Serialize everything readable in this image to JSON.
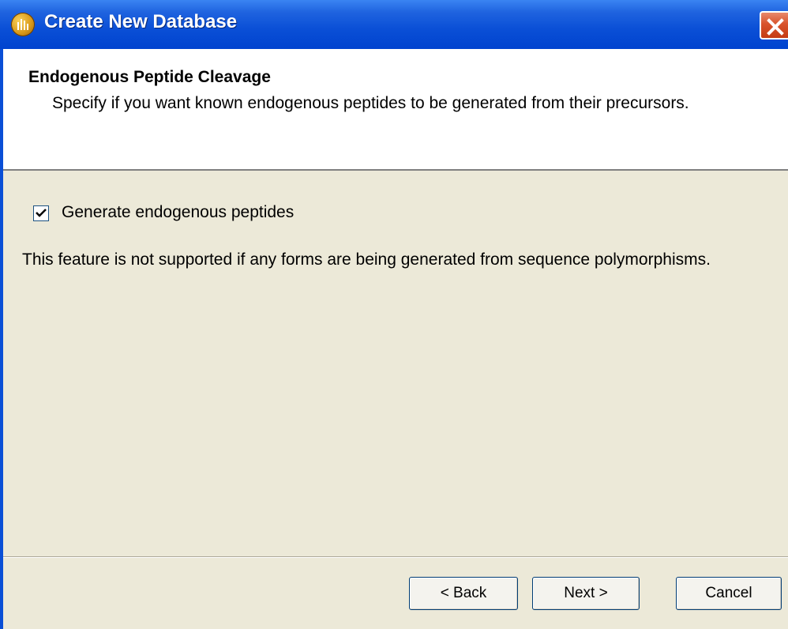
{
  "window": {
    "title": "Create New Database",
    "icon": "app-logo-icon",
    "close_icon": "close-icon"
  },
  "header": {
    "title": "Endogenous Peptide Cleavage",
    "description": "Specify if you want known endogenous peptides to be generated from their precursors."
  },
  "options": {
    "generate_checkbox": {
      "label": "Generate endogenous peptides",
      "checked": true
    }
  },
  "note": "This feature is not supported if any forms are being generated from sequence polymorphisms.",
  "buttons": {
    "back": "< Back",
    "next": "Next >",
    "cancel": "Cancel"
  },
  "colors": {
    "titlebar": "#0a4fd6",
    "dialog_bg": "#ECE9D8",
    "close_button": "#d8532c"
  }
}
